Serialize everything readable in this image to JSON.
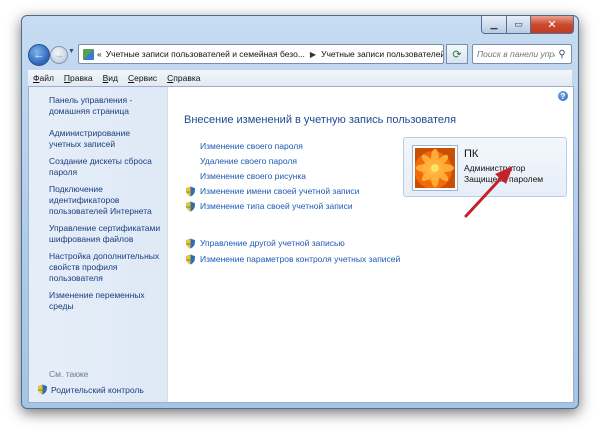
{
  "window": {
    "caption_buttons": {
      "minimize_icon": "minimize-icon",
      "maximize_icon": "maximize-icon",
      "close_icon": "close-icon"
    }
  },
  "nav": {
    "back_icon": "back-arrow-icon",
    "forward_icon": "forward-arrow-icon",
    "address_prefix": "«",
    "breadcrumb": [
      "Учетные записи пользователей и семейная безо...",
      "Учетные записи пользователей"
    ],
    "search_placeholder": "Поиск в панели управления"
  },
  "menu": [
    "Файл",
    "Правка",
    "Вид",
    "Сервис",
    "Справка"
  ],
  "sidebar": {
    "home_link": "Панель управления - домашняя страница",
    "tasks": [
      "Администрирование учетных записей",
      "Создание дискеты сброса пароля",
      "Подключение идентификаторов пользователей Интернета",
      "Управление сертификатами шифрования файлов",
      "Настройка дополнительных свойств профиля пользователя",
      "Изменение переменных среды"
    ],
    "see_also_heading": "См. также",
    "see_also_items": [
      "Родительский контроль"
    ]
  },
  "main": {
    "title": "Внесение изменений в учетную запись пользователя",
    "links": [
      {
        "label": "Изменение своего пароля",
        "shield": false
      },
      {
        "label": "Удаление своего пароля",
        "shield": false
      },
      {
        "label": "Изменение своего рисунка",
        "shield": false
      },
      {
        "label": "Изменение имени своей учетной записи",
        "shield": true
      },
      {
        "label": "Изменение типа своей учетной записи",
        "shield": true
      }
    ],
    "other_links": [
      {
        "label": "Управление другой учетной записью",
        "shield": true
      },
      {
        "label": "Изменение параметров контроля учетных записей",
        "shield": true
      }
    ]
  },
  "user": {
    "name": "ПК",
    "role": "Администратор",
    "status": "Защищена паролем"
  },
  "colors": {
    "link": "#1c5ab5",
    "title": "#1c4a93",
    "annotation_arrow": "#c4222a"
  }
}
